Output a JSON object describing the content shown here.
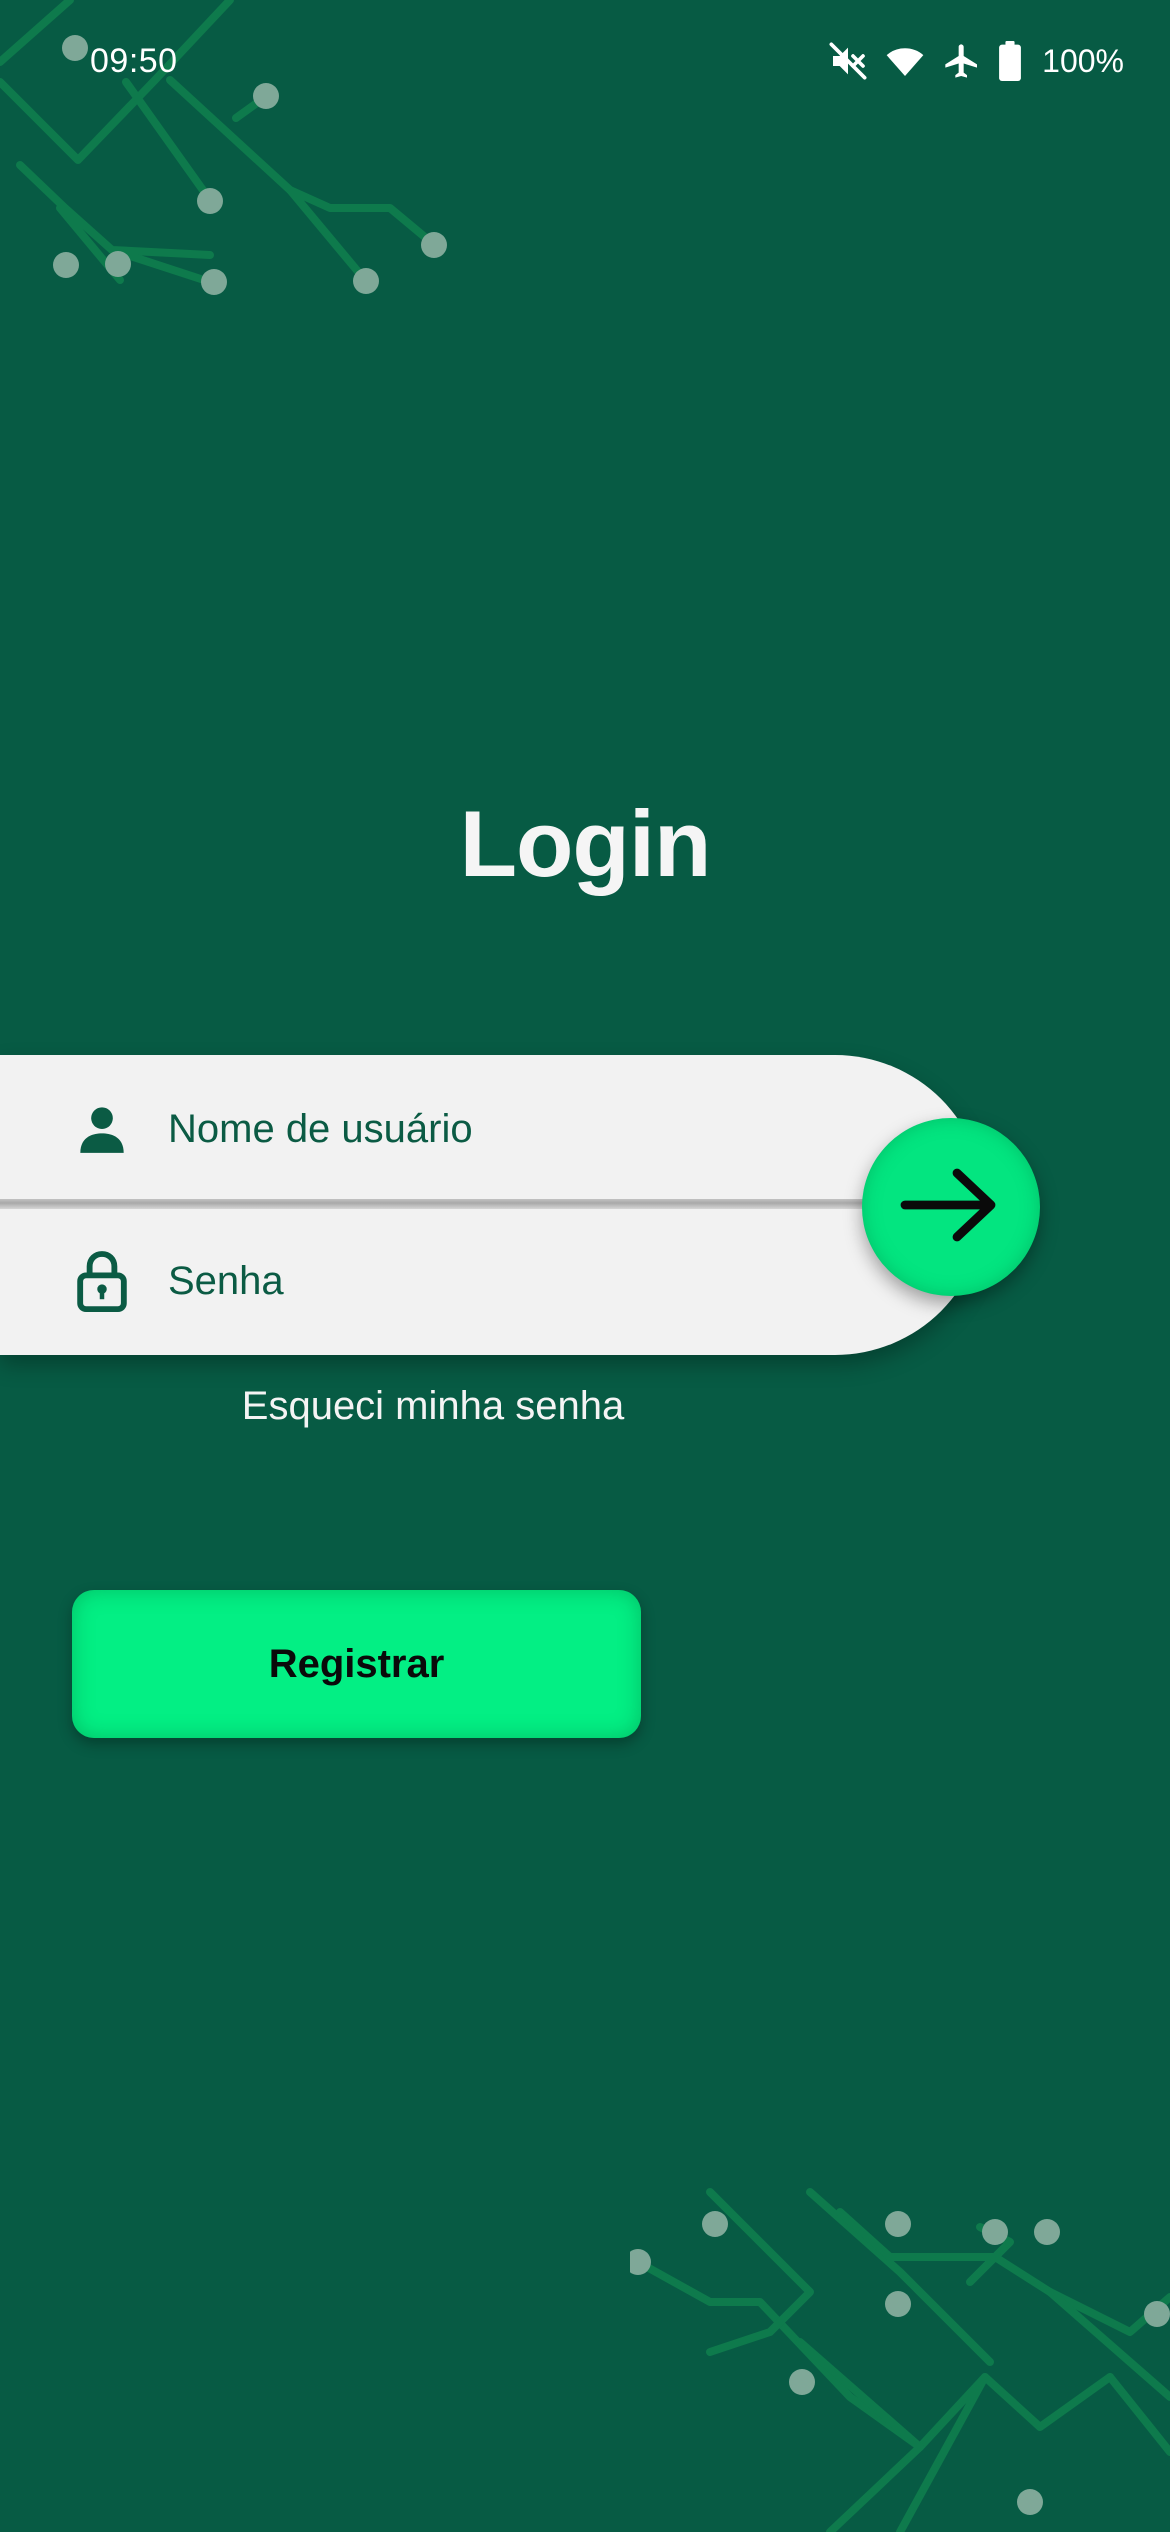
{
  "colors": {
    "background": "#075b44",
    "accent": "#03e580",
    "field_background": "#f2f2f2",
    "field_text": "#0b5b44",
    "circuit_line": "#0e7a4c",
    "circuit_dot": "#7fa898"
  },
  "status_bar": {
    "time": "09:50",
    "battery_text": "100%",
    "icons": [
      "mute-icon",
      "wifi-icon",
      "airplane-mode-icon",
      "battery-icon"
    ]
  },
  "login": {
    "title": "Login",
    "username_placeholder": "Nome de usuário",
    "password_placeholder": "Senha",
    "username_icon": "person-icon",
    "password_icon": "lock-icon",
    "submit_icon": "arrow-right-icon",
    "forgot_password": "Esqueci minha senha",
    "register_label": "Registrar"
  }
}
